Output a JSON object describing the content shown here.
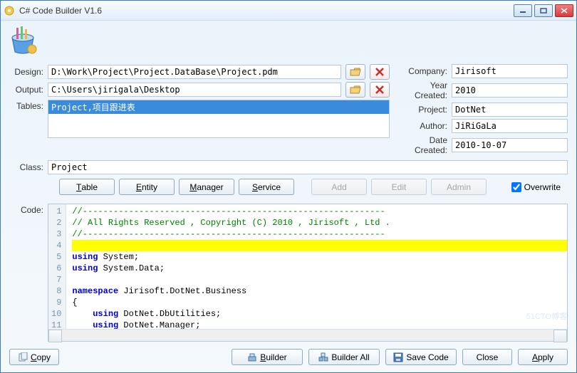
{
  "title": "C# Code Builder V1.6",
  "labels": {
    "design": "Design:",
    "output": "Output:",
    "tables": "Tables:",
    "class": "Class:",
    "company": "Company:",
    "year_created": "Year Created:",
    "project": "Project:",
    "author": "Author:",
    "date_created": "Date Created:",
    "code": "Code:"
  },
  "fields": {
    "design": "D:\\Work\\Project\\Project.DataBase\\Project.pdm",
    "output": "C:\\Users\\jirigala\\Desktop",
    "class": "Project",
    "company": "Jirisoft",
    "year_created": "2010",
    "project": "DotNet",
    "author": "JiRiGaLa",
    "date_created": "2010-10-07"
  },
  "tables": [
    "Project,项目跟进表"
  ],
  "buttons": {
    "table_u": "T",
    "table_rest": "able",
    "entity_u": "E",
    "entity_rest": "ntity",
    "manager_u": "M",
    "manager_rest": "anager",
    "service_u": "S",
    "service_rest": "ervice",
    "add": "Add",
    "edit": "Edit",
    "admin": "Admin",
    "overwrite": "Overwrite",
    "copy_u": "C",
    "copy_rest": "opy",
    "builder_u": "B",
    "builder_rest": "uilder",
    "builder_all": "Builder All",
    "save_code": "Save Code",
    "close": "Close",
    "apply_u": "A",
    "apply_rest": "pply"
  },
  "overwrite_checked": true,
  "code": {
    "lines": [
      {
        "n": 1,
        "kind": "comment",
        "t": "//-----------------------------------------------------------"
      },
      {
        "n": 2,
        "kind": "comment",
        "t": "// All Rights Reserved , Copyright (C) 2010 , Jirisoft , Ltd ."
      },
      {
        "n": 3,
        "kind": "comment",
        "t": "//-----------------------------------------------------------"
      },
      {
        "n": 4,
        "kind": "highlight",
        "t": ""
      },
      {
        "n": 5,
        "kind": "using",
        "ns": "System;"
      },
      {
        "n": 6,
        "kind": "using",
        "ns": "System.Data;"
      },
      {
        "n": 7,
        "kind": "blank",
        "t": ""
      },
      {
        "n": 8,
        "kind": "namespace",
        "ns": "Jirisoft.DotNet.Business"
      },
      {
        "n": 9,
        "kind": "plain",
        "t": "{"
      },
      {
        "n": 10,
        "kind": "using-in",
        "ns": "DotNet.DbUtilities;"
      },
      {
        "n": 11,
        "kind": "using-in",
        "ns": "DotNet.Manager;"
      }
    ]
  },
  "watermark": "51CTO博客"
}
